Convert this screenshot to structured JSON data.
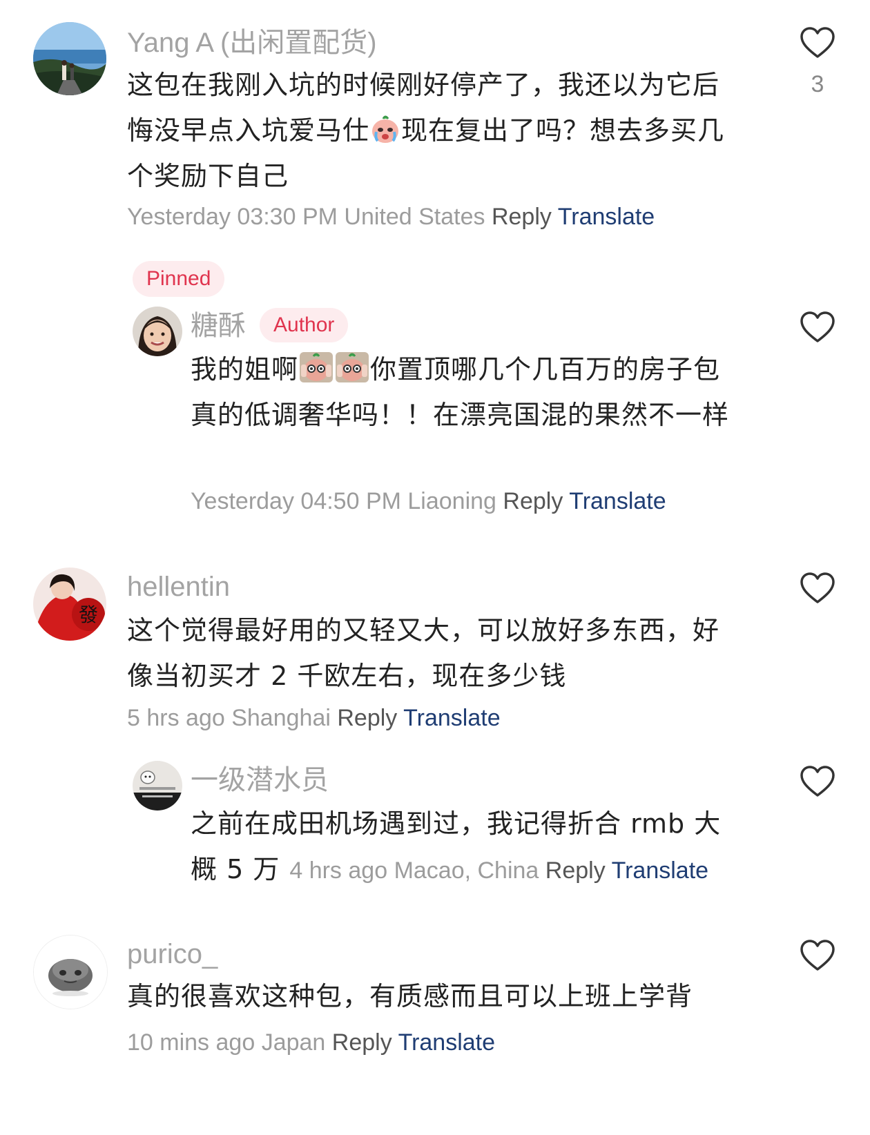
{
  "colors": {
    "username": "#a3a3a3",
    "badge_bg": "#fdecee",
    "badge_text": "#e0344e",
    "meta": "#9c9c9c",
    "reply": "#555555",
    "translate": "#1f3d73"
  },
  "labels": {
    "reply": "Reply",
    "translate": "Translate",
    "pinned": "Pinned",
    "author": "Author"
  },
  "comments": [
    {
      "username": "Yang A (出闲置配货)",
      "avatar_icon": "beach-photo-avatar",
      "text_parts": [
        "这包在我刚入坑的时候刚好停产了，我还以为它后悔没早点入坑爱马仕",
        "现在复出了吗？想去多买几个奖励下自己"
      ],
      "emoji_icons": [
        "crying-peach-emoji"
      ],
      "time": "Yesterday 03:30 PM",
      "location": "United States",
      "likes": "3",
      "pinned": true,
      "reply": {
        "username": "糖酥",
        "avatar_icon": "smiling-girl-avatar",
        "is_author": true,
        "text_parts": [
          "我的姐啊",
          "",
          "你置顶哪几个几百万的房子包真的低调奢华吗！！在漂亮国混的果然不一样"
        ],
        "emoji_icons": [
          "peeking-peach-emoji",
          "peeking-peach-emoji"
        ],
        "time": "Yesterday 04:50 PM",
        "location": "Liaoning"
      }
    },
    {
      "username": "hellentin",
      "avatar_icon": "red-dress-avatar",
      "text": "这个觉得最好用的又轻又大，可以放好多东西，好像当初买才 2 千欧左右，现在多少钱",
      "time": "5 hrs ago",
      "location": "Shanghai",
      "reply": {
        "username": "一级潜水员",
        "avatar_icon": "cat-meme-avatar",
        "text": "之前在成田机场遇到过，我记得折合 rmb 大概 5 万",
        "time": "4 hrs ago",
        "location": "Macao, China"
      }
    },
    {
      "username": "purico_",
      "avatar_icon": "stone-creature-avatar",
      "text": "真的很喜欢这种包，有质感而且可以上班上学背",
      "time": "10 mins ago",
      "location": "Japan"
    }
  ]
}
